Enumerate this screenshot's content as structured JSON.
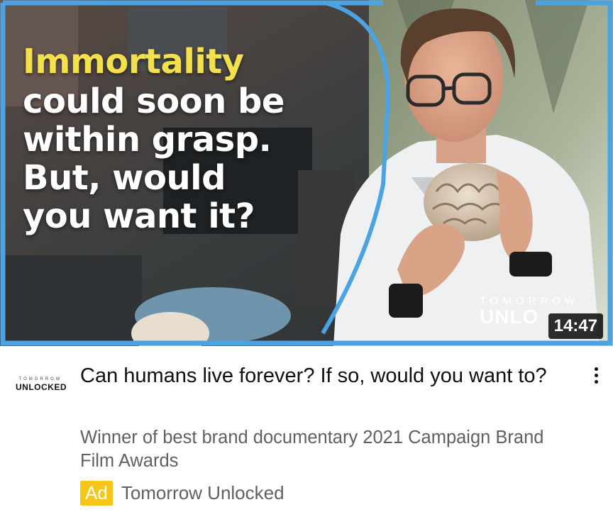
{
  "thumbnail": {
    "headline_highlight": "Immortality",
    "headline_rest": "could soon be\nwithin grasp.\nBut, would\nyou want it?",
    "watermark_top": "TOMORROW",
    "watermark_bottom": "UNLO",
    "duration": "14:47",
    "highlight_color": "#f4e04d",
    "frame_color": "#4ba3e3"
  },
  "video": {
    "channel_logo_top": "TOMORROW",
    "channel_logo_bottom": "UNLOCKED",
    "title": "Can humans live forever? If so, would you want to?",
    "description": "Winner of best brand documentary 2021 Campaign Brand Film Awards",
    "ad_label": "Ad",
    "advertiser": "Tomorrow Unlocked",
    "ad_color": "#f5c518"
  }
}
